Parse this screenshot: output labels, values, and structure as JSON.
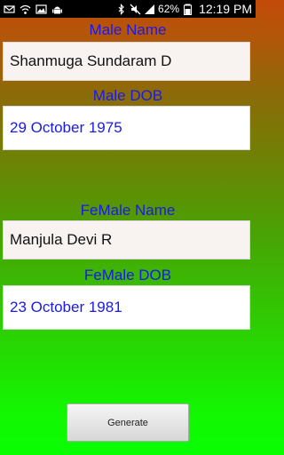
{
  "status_bar": {
    "left_icons": [
      "mail-icon",
      "wifi-icon",
      "gallery-icon",
      "android-icon"
    ],
    "right_icons": [
      "bluetooth-icon",
      "mute-icon",
      "signal-icon"
    ],
    "battery": "62%",
    "time": "12:19 PM"
  },
  "form": {
    "male_name_label": "Male Name",
    "male_name_value": "Shanmuga Sundaram D",
    "male_dob_label": "Male DOB",
    "male_dob_value": "29 October 1975",
    "female_name_label": "FeMale Name",
    "female_name_value": "Manjula Devi R",
    "female_dob_label": "FeMale DOB",
    "female_dob_value": "23 October 1981"
  },
  "actions": {
    "generate_label": "Generate"
  }
}
